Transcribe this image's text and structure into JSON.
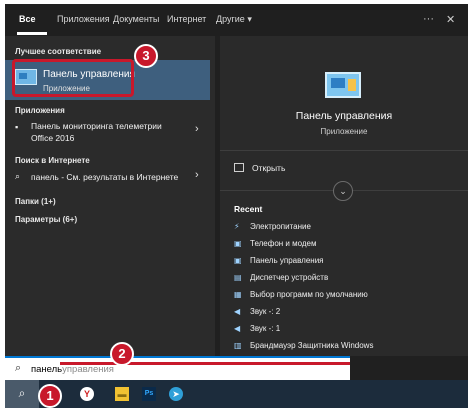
{
  "tabs": {
    "items": [
      {
        "label": "Все",
        "active": true
      },
      {
        "label": "Приложения"
      },
      {
        "label": "Документы"
      },
      {
        "label": "Интернет"
      },
      {
        "label": "Другие"
      }
    ],
    "more_icon": "ellipsis-icon",
    "close_icon": "close-icon"
  },
  "left": {
    "best_match_heading": "Лучшее соответствие",
    "best_match": {
      "title": "Панель управления",
      "subtitle": "Приложение"
    },
    "apps_heading": "Приложения",
    "app_item": {
      "line1": "Панель мониторинга телеметрии",
      "line2": "Office 2016"
    },
    "web_heading": "Поиск в Интернете",
    "web_item": "панель - См. результаты в Интернете",
    "folders": "Папки (1+)",
    "settings": "Параметры (6+)"
  },
  "right": {
    "title": "Панель управления",
    "subtitle": "Приложение",
    "open_label": "Открыть",
    "recent_title": "Recent",
    "recent": [
      "Электропитание",
      "Телефон и модем",
      "Панель управления",
      "Диспетчер устройств",
      "Выбор программ по умолчанию",
      "Звук -: 2",
      "Звук -: 1",
      "Брандмауэр Защитника Windows"
    ]
  },
  "search": {
    "value": "панель",
    "placeholder": "управления"
  },
  "badges": {
    "one": "1",
    "two": "2",
    "three": "3"
  },
  "colors": {
    "accent": "#0078d4",
    "highlight": "#3e5f7e",
    "annotation": "#c8182b"
  }
}
